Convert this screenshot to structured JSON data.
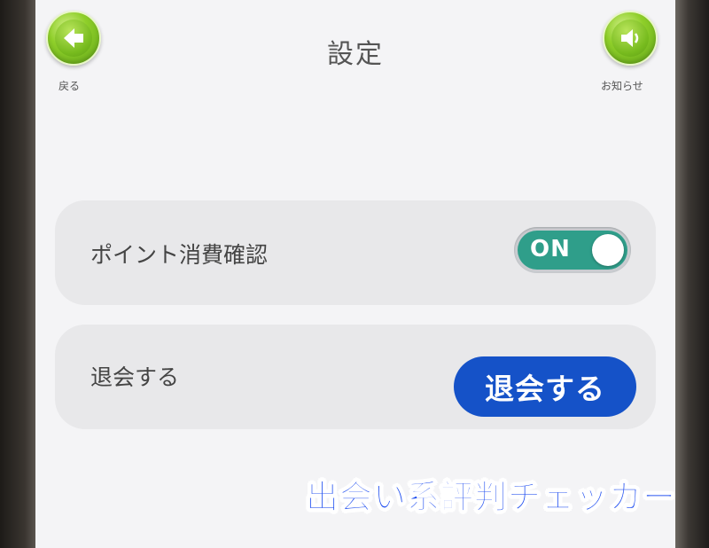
{
  "header": {
    "title": "設定",
    "back": {
      "label": "戻る",
      "icon": "arrow-left-icon"
    },
    "notice": {
      "label": "お知らせ",
      "icon": "speaker-icon"
    }
  },
  "settings": {
    "point_confirm": {
      "label": "ポイント消費確認",
      "toggle_text": "ON",
      "state": true
    },
    "withdraw": {
      "label": "退会する",
      "button_label": "退会する"
    }
  },
  "watermark": {
    "text": "出会い系評判チェッカー"
  },
  "colors": {
    "screen_bg": "#f4f4f6",
    "card_bg": "#e8e8ea",
    "toggle_on": "#2f9e8a",
    "primary_button": "#1552c8",
    "nav_button_green": "#7cc11e",
    "watermark": "#1e4df0"
  }
}
